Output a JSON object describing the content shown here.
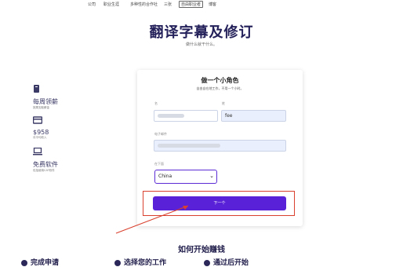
{
  "nav": {
    "items": [
      {
        "label": "公司"
      },
      {
        "label": "职业生涯"
      },
      {
        "label": "多种性的合作社"
      },
      {
        "label": "三张"
      },
      {
        "label": "自由职业者",
        "active": true
      },
      {
        "label": "博客"
      }
    ]
  },
  "hero": {
    "title": "翻译字幕及修订",
    "subtitle": "做什么就干什么。"
  },
  "sidebar": {
    "blocks": [
      {
        "icon": "book-icon",
        "title": "每周领薪",
        "desc": "按周支取薪金"
      },
      {
        "icon": "card-icon",
        "title": "$958",
        "desc": "月平均收入"
      },
      {
        "icon": "laptop-icon",
        "title": "免费软件",
        "desc": "包括使用CAT软件"
      }
    ]
  },
  "form": {
    "title": "做一个小角色",
    "subtitle": "自由自在地工作，不用一个小时。",
    "first_name_label": "名",
    "last_name_label": "姓",
    "last_name_value": "fee",
    "email_label": "电子邮件",
    "country_label": "在下面",
    "country_value": "China",
    "next_button": "下一个"
  },
  "how": {
    "title": "如何开始赚钱",
    "steps": [
      "完成申请",
      "选择您的工作",
      "通过后开始"
    ]
  },
  "colors": {
    "accent": "#5a22d8",
    "highlight": "#d9402e",
    "heading": "#23205a"
  }
}
